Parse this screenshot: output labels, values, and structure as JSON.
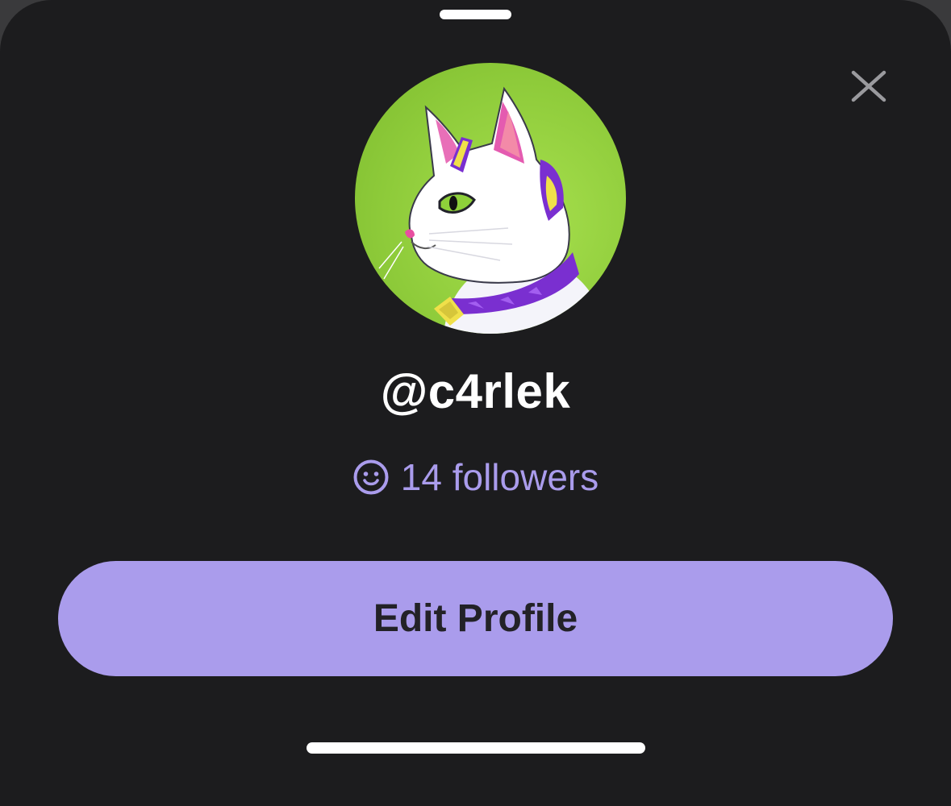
{
  "sheet": {
    "grabber": "drag-handle",
    "close_icon": "close-icon"
  },
  "profile": {
    "avatar_description": "cat-avatar",
    "username": "@c4rlek",
    "followers_icon": "smiley-icon",
    "followers_text": "14 followers"
  },
  "actions": {
    "edit_profile_label": "Edit Profile"
  },
  "colors": {
    "background": "#1c1c1e",
    "accent": "#aa9cec",
    "button_text": "#232227",
    "avatar_bg": "#8ecb3a"
  }
}
